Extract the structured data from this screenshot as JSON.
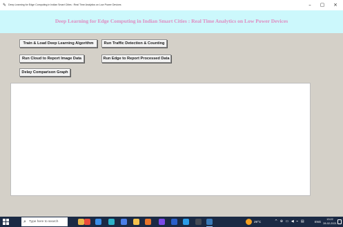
{
  "window": {
    "title": "Deep Learning for Edge Computing in Indian Smart Cities : Real Time Analytics on Low Power Devices",
    "minimize_glyph": "–",
    "maximize_glyph": "▢",
    "close_glyph": "×"
  },
  "header": {
    "title": "Deep Learning for Edge Computing in Indian Smart Cities : Real Time Analytics on Low Power Devices",
    "background": "#ccf8fc",
    "title_color": "#e08ac0"
  },
  "buttons": {
    "train": "Train & Load Deep Learning Algorithm",
    "traffic": "Run Traffic Detection & Counting",
    "cloud": "Run Cloud to Report Image Data",
    "edge": "Run Edge to Report Processed Data",
    "delay": "Delay Comparison Graph"
  },
  "taskbar": {
    "search_placeholder": "Type here to search",
    "weather": "29°C",
    "tray_icons": "^ ⊕ ▭ ◀ ⌁ ▤",
    "language": "ENG",
    "time": "13:22",
    "date": "28-02-2021",
    "apps": [
      {
        "name": "task-view-icon",
        "color": "#e8b84a"
      },
      {
        "name": "chrome-icon",
        "color": "#e84a3a"
      },
      {
        "name": "store-icon",
        "color": "#3a8ee8"
      },
      {
        "name": "edge-icon",
        "color": "#2bb3c9"
      },
      {
        "name": "mail-icon",
        "color": "#4a7ee8"
      },
      {
        "name": "folder-icon",
        "color": "#f2c14e"
      },
      {
        "name": "firefox-icon",
        "color": "#e8742a"
      },
      {
        "name": "media-icon",
        "color": "#7a4ae8"
      },
      {
        "name": "word-icon",
        "color": "#2b5fc9"
      },
      {
        "name": "vscode-icon",
        "color": "#2a9be8"
      },
      {
        "name": "terminal-icon",
        "color": "#444a55"
      },
      {
        "name": "python-icon",
        "color": "#3a7ab8"
      }
    ]
  }
}
